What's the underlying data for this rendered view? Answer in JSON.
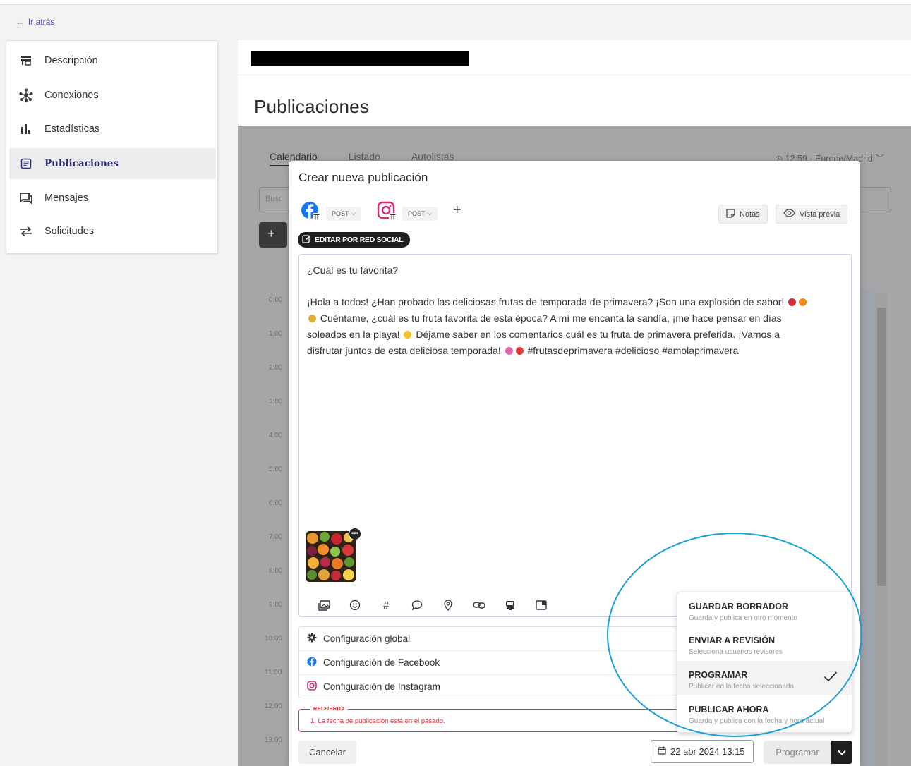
{
  "nav": {
    "back_label": "Ir atrás"
  },
  "sidebar": {
    "items": [
      {
        "label": "Descripción",
        "icon": "storefront-icon"
      },
      {
        "label": "Conexiones",
        "icon": "network-icon"
      },
      {
        "label": "Estadísticas",
        "icon": "bar-chart-icon"
      },
      {
        "label": "Publicaciones",
        "icon": "document-icon",
        "active": true
      },
      {
        "label": "Mensajes",
        "icon": "chat-icon"
      },
      {
        "label": "Solicitudes",
        "icon": "swap-icon"
      }
    ]
  },
  "page": {
    "title": "Publicaciones"
  },
  "background": {
    "tabs": [
      "Calendario",
      "Listado",
      "Autolistas"
    ],
    "timezone": "12:59 - Europe/Madrid",
    "search_placeholder": "Busc",
    "hours": [
      "0:00",
      "1:00",
      "2:00",
      "3:00",
      "4:00",
      "5:00",
      "6:00",
      "7:00",
      "8:00",
      "9:00",
      "10:00",
      "11:00",
      "12:00",
      "13:00"
    ]
  },
  "modal": {
    "title": "Crear nueva publicación",
    "networks": [
      {
        "name": "Facebook",
        "type": "POST",
        "color": "#1877f2"
      },
      {
        "name": "Instagram",
        "type": "POST",
        "color": "#d62976"
      }
    ],
    "notes_label": "Notas",
    "preview_label": "Vista previa",
    "edit_by_network_label": "EDITAR POR RED SOCIAL",
    "editor": {
      "title": "¿Cuál es tu favorita?",
      "line1": "¡Hola a todos! ¿Han probado las deliciosas frutas de temporada de primavera? ¡Son una explosión de sabor!",
      "line2": "Cuéntame, ¿cuál es tu fruta favorita de esta época? A mí me encanta la sandía, ¡me hace pensar en días",
      "line3a": "soleados en la playa!",
      "line3b": "Déjame saber en los comentarios cuál es tu fruta de primavera preferida. ¡Vamos a",
      "line4a": "disfrutar juntos de esta deliciosa temporada!",
      "line4b": "#frutasdeprimavera #delicioso #amolaprimavera"
    },
    "toolbar_icons": [
      "image-icon",
      "emoji-icon",
      "hashtag-icon",
      "comment-icon",
      "location-icon",
      "link-icon",
      "stamp-icon",
      "media-icon"
    ],
    "config": [
      {
        "label": "Configuración global",
        "icon": "gear-icon"
      },
      {
        "label": "Configuración de Facebook",
        "icon": "facebook-icon"
      },
      {
        "label": "Configuración de Instagram",
        "icon": "instagram-icon"
      }
    ],
    "warning": {
      "tag": "RECUERDA",
      "text": "1. La fecha de publicación está en el pasado."
    },
    "cancel_label": "Cancelar",
    "date_label": "22 abr 2024 13:15",
    "schedule_label": "Programar",
    "menu": [
      {
        "title": "GUARDAR BORRADOR",
        "subtitle": "Guarda y publica en otro momento"
      },
      {
        "title": "ENVIAR A REVISIÓN",
        "subtitle": "Selecciona usuarios revisores"
      },
      {
        "title": "PROGRAMAR",
        "subtitle": "Publicar en la fecha seleccionada",
        "selected": true
      },
      {
        "title": "PUBLICAR AHORA",
        "subtitle": "Guarda y publica con la fecha y hora actual"
      }
    ]
  },
  "colors": {
    "accent": "#3b3fb5",
    "highlight": "#1aa0d8",
    "error": "#d9333d"
  }
}
